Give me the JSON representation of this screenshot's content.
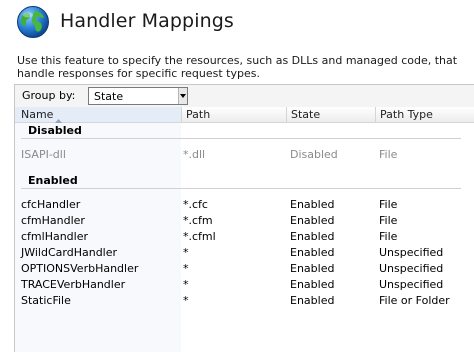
{
  "header": {
    "title": "Handler Mappings",
    "icon": "globe-icon"
  },
  "description": "Use this feature to specify the resources, such as DLLs and managed code, that handle responses for specific request types.",
  "groupby": {
    "label": "Group by:",
    "value": "State"
  },
  "columns": {
    "name": "Name",
    "path": "Path",
    "state": "State",
    "path_type": "Path Type"
  },
  "groups": [
    {
      "label": "Disabled",
      "rows": [
        {
          "name": "ISAPI-dll",
          "path": "*.dll",
          "state": "Disabled",
          "path_type": "File"
        }
      ]
    },
    {
      "label": "Enabled",
      "rows": [
        {
          "name": "cfcHandler",
          "path": "*.cfc",
          "state": "Enabled",
          "path_type": "File"
        },
        {
          "name": "cfmHandler",
          "path": "*.cfm",
          "state": "Enabled",
          "path_type": "File"
        },
        {
          "name": "cfmlHandler",
          "path": "*.cfml",
          "state": "Enabled",
          "path_type": "File"
        },
        {
          "name": "JWildCardHandler",
          "path": "*",
          "state": "Enabled",
          "path_type": "Unspecified"
        },
        {
          "name": "OPTIONSVerbHandler",
          "path": "*",
          "state": "Enabled",
          "path_type": "Unspecified"
        },
        {
          "name": "TRACEVerbHandler",
          "path": "*",
          "state": "Enabled",
          "path_type": "Unspecified"
        },
        {
          "name": "StaticFile",
          "path": "*",
          "state": "Enabled",
          "path_type": "File or Folder"
        }
      ]
    }
  ]
}
